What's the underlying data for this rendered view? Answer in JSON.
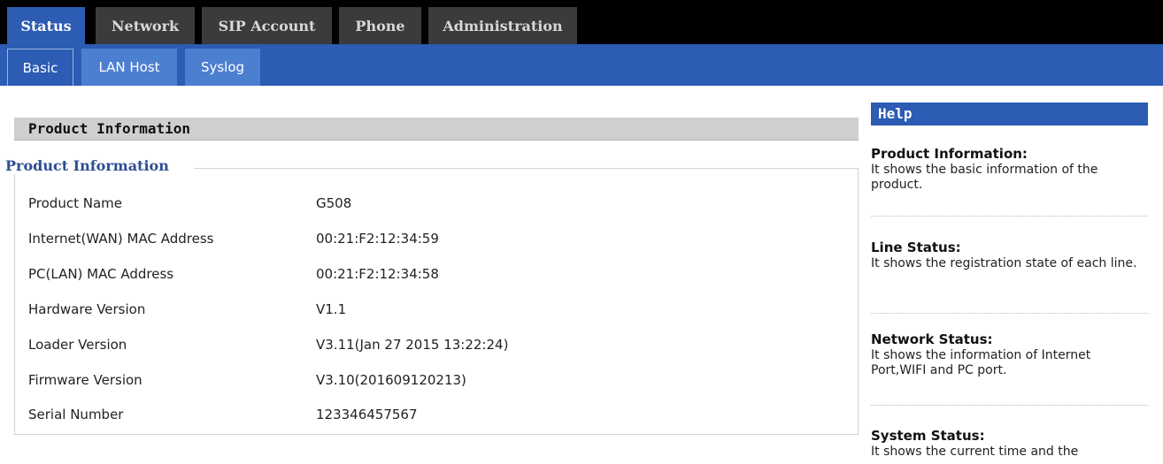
{
  "nav": {
    "main_tabs": [
      "Status",
      "Network",
      "SIP Account",
      "Phone",
      "Administration"
    ],
    "active_main": "Status",
    "sub_tabs": [
      "Basic",
      "LAN Host",
      "Syslog"
    ],
    "active_sub": "Basic"
  },
  "main": {
    "section_title": "Product Information",
    "group_legend": "Product Information",
    "rows": [
      {
        "label": "Product Name",
        "value": "G508"
      },
      {
        "label": "Internet(WAN) MAC Address",
        "value": "00:21:F2:12:34:59"
      },
      {
        "label": "PC(LAN) MAC Address",
        "value": "00:21:F2:12:34:58"
      },
      {
        "label": "Hardware Version",
        "value": "V1.1"
      },
      {
        "label": "Loader Version",
        "value": "V3.11(Jan 27 2015 13:22:24)"
      },
      {
        "label": "Firmware Version",
        "value": "V3.10(201609120213)"
      },
      {
        "label": "Serial Number",
        "value": "123346457567"
      }
    ]
  },
  "help": {
    "title": "Help",
    "items": [
      {
        "heading": "Product Information:",
        "text": "It shows the basic information of the product."
      },
      {
        "heading": "Line Status:",
        "text": "It shows the registration state of each line."
      },
      {
        "heading": "Network Status:",
        "text": "It shows the information of Internet Port,WIFI and PC port."
      },
      {
        "heading": "System Status:",
        "text": "It shows the current time and the"
      }
    ]
  },
  "colors": {
    "accent": "#2c5cb3",
    "topbar": "#000000",
    "tab_inactive": "#3b3b3b",
    "subtab_inactive": "#4d7fd1",
    "section_header": "#cfcfcf",
    "legend_text": "#2d4f92"
  }
}
